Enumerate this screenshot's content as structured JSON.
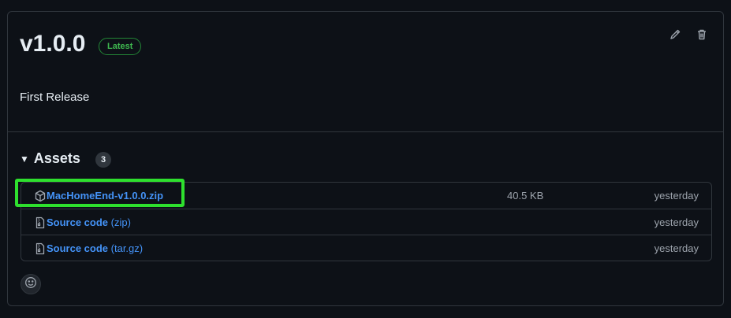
{
  "release": {
    "title": "v1.0.0",
    "badge": "Latest",
    "description": "First Release",
    "edit_icon": "pencil-icon",
    "delete_icon": "trash-icon"
  },
  "assets": {
    "title": "Assets",
    "count": "3",
    "items": [
      {
        "icon": "package-icon",
        "name": "MacHomeEnd-v1.0.0.zip",
        "suffix": "",
        "size": "40.5 KB",
        "time": "yesterday"
      },
      {
        "icon": "file-zip-icon",
        "name": "Source code",
        "suffix": " (zip)",
        "size": "",
        "time": "yesterday"
      },
      {
        "icon": "file-zip-icon",
        "name": "Source code",
        "suffix": " (tar.gz)",
        "size": "",
        "time": "yesterday"
      }
    ]
  },
  "reactions": {
    "icon": "smiley-icon"
  },
  "colors": {
    "background": "#0d1117",
    "border": "#30363d",
    "link": "#4493f8",
    "badge_green": "#3fb950",
    "highlight": "#2ee02e"
  }
}
